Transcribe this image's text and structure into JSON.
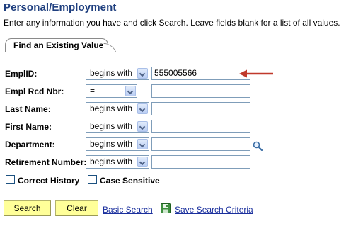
{
  "page": {
    "title": "Personal/Employment",
    "instructions": "Enter any information you have and click Search. Leave fields blank for a list of all values."
  },
  "tab": {
    "label": "Find an Existing Value"
  },
  "fields": [
    {
      "label": "EmplID:",
      "operator": "begins with",
      "value": "555005566"
    },
    {
      "label": "Empl Rcd Nbr:",
      "operator": "=",
      "value": ""
    },
    {
      "label": "Last Name:",
      "operator": "begins with",
      "value": ""
    },
    {
      "label": "First Name:",
      "operator": "begins with",
      "value": ""
    },
    {
      "label": "Department:",
      "operator": "begins with",
      "value": ""
    },
    {
      "label": "Retirement Number:",
      "operator": "begins with",
      "value": ""
    }
  ],
  "checkboxes": {
    "correct_history": {
      "label": "Correct History",
      "checked": false
    },
    "case_sensitive": {
      "label": "Case Sensitive",
      "checked": false
    }
  },
  "buttons": {
    "search": "Search",
    "clear": "Clear"
  },
  "links": {
    "basic_search": "Basic Search",
    "save_search": "Save Search Criteria"
  },
  "icons": {
    "lookup": "magnifier-icon",
    "save": "save-floppy-icon",
    "annotation": "red-arrow-icon"
  },
  "colors": {
    "title": "#1f3f7f",
    "button_bg": "#ffff99",
    "link": "#1a2f9d",
    "arrow": "#c0392b"
  }
}
